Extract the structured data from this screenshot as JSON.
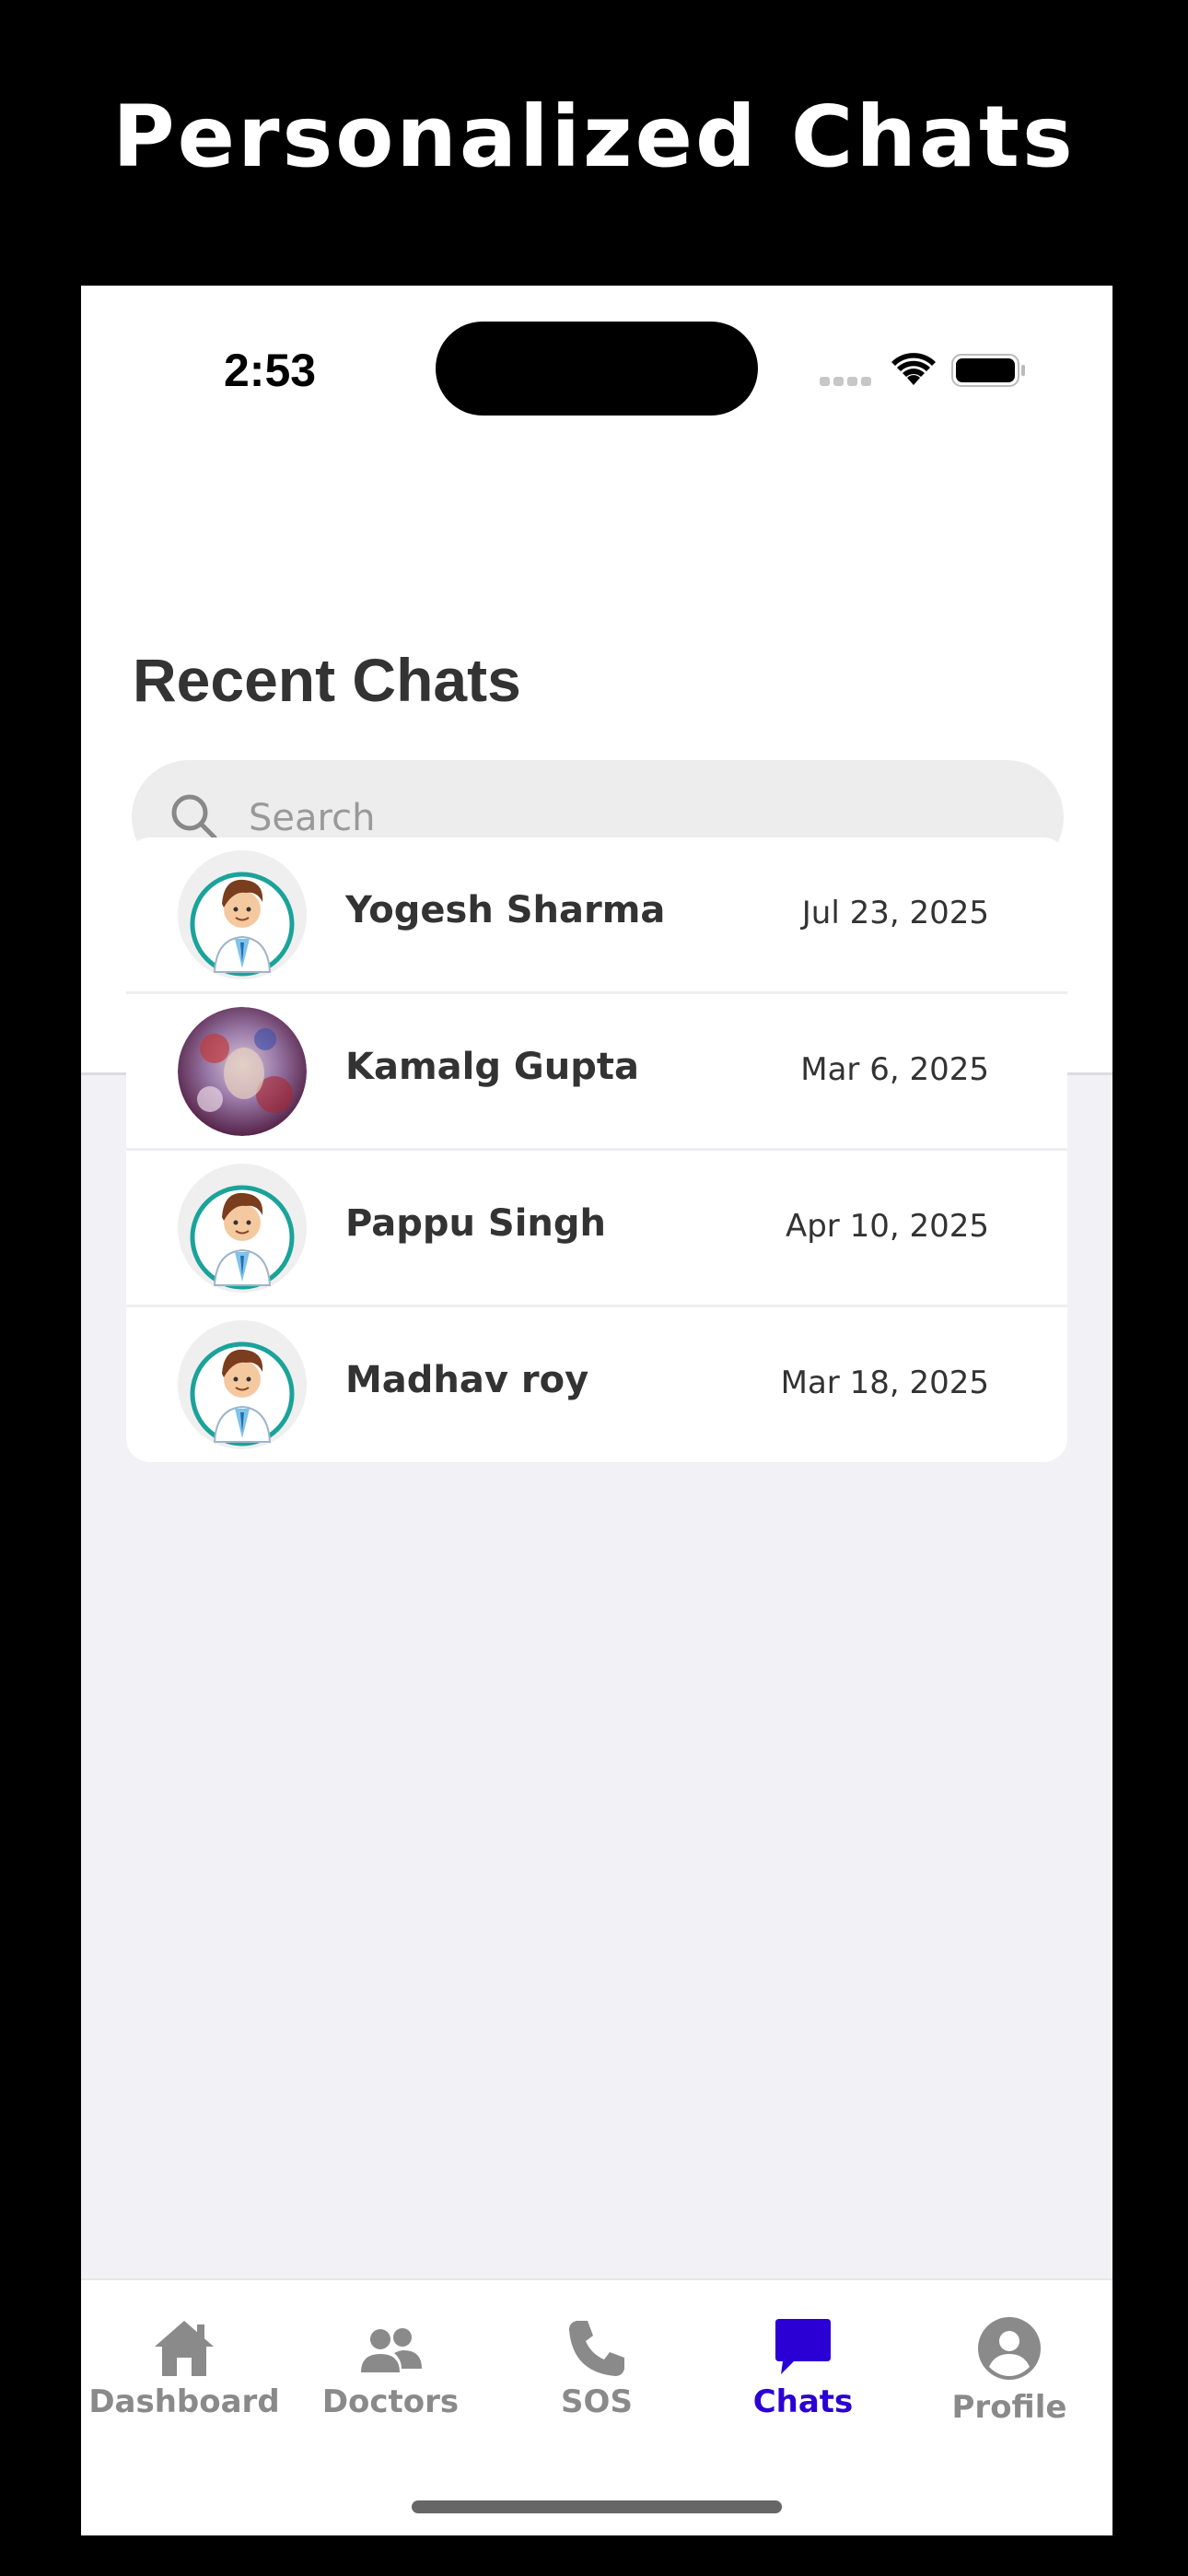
{
  "promo": {
    "headline": "Personalized Chats"
  },
  "status_bar": {
    "time": "2:53"
  },
  "header": {
    "title": "Recent Chats",
    "search": {
      "placeholder": "Search",
      "value": ""
    }
  },
  "chats": [
    {
      "name": "Yogesh Sharma",
      "date": "Jul 23, 2025",
      "avatar": "doctor-avatar"
    },
    {
      "name": "Kamalg Gupta",
      "date": "Mar 6, 2025",
      "avatar": "photo-avatar"
    },
    {
      "name": "Pappu Singh",
      "date": "Apr 10, 2025",
      "avatar": "doctor-avatar"
    },
    {
      "name": "Madhav roy",
      "date": "Mar 18, 2025",
      "avatar": "doctor-avatar"
    }
  ],
  "tabbar": {
    "items": [
      {
        "label": "Dashboard",
        "icon": "home-icon",
        "active": false
      },
      {
        "label": "Doctors",
        "icon": "people-icon",
        "active": false
      },
      {
        "label": "SOS",
        "icon": "phone-icon",
        "active": false
      },
      {
        "label": "Chats",
        "icon": "chat-bubble-icon",
        "active": true
      },
      {
        "label": "Profile",
        "icon": "user-circle-icon",
        "active": false
      }
    ]
  },
  "colors": {
    "accent": "#2b00d4",
    "inactive": "#8a8a8a",
    "background": "#f1f1f6"
  }
}
